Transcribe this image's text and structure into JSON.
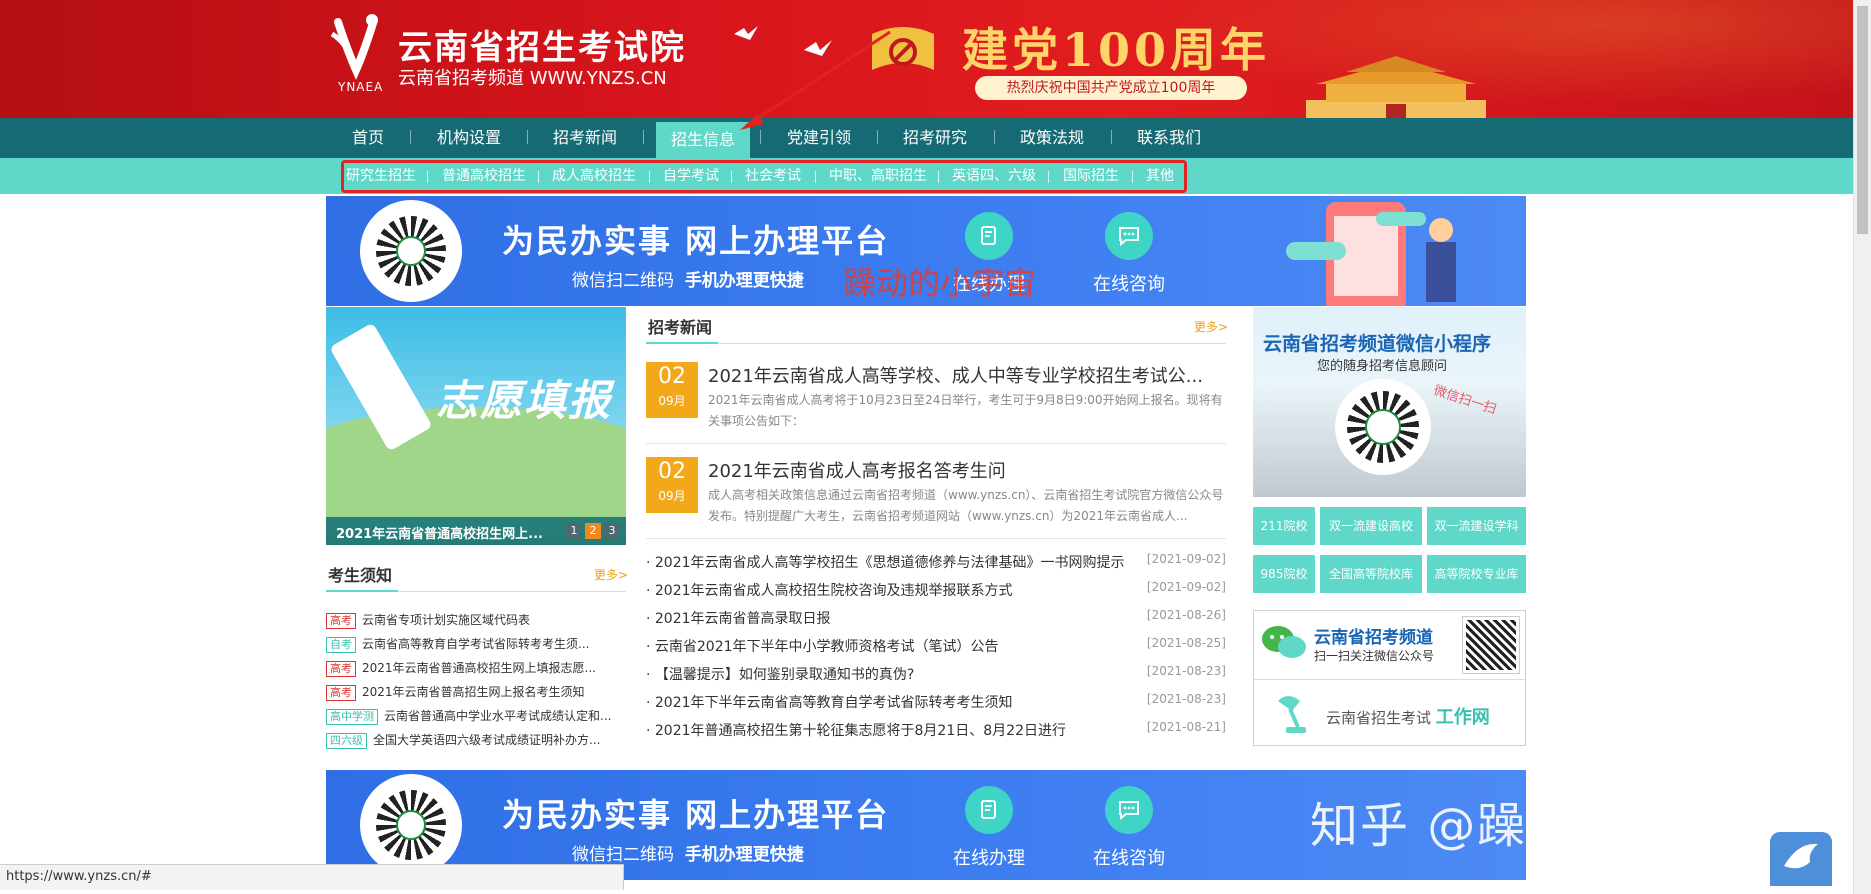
{
  "header": {
    "logo_abbr": "YNAEA",
    "site_title": "云南省招生考试院",
    "site_subtitle": "云南省招考频道 WWW.YNZS.CN",
    "party_title": "建党100周年",
    "party_subtitle": "热烈庆祝中国共产党成立100周年"
  },
  "nav": {
    "items": [
      "首页",
      "机构设置",
      "招考新闻",
      "招生信息",
      "党建引领",
      "招考研究",
      "政策法规",
      "联系我们"
    ],
    "active_index": 3
  },
  "subnav": {
    "items": [
      "研究生招生",
      "普通高校招生",
      "成人高校招生",
      "自学考试",
      "社会考试",
      "中职、高职招生",
      "英语四、六级",
      "国际招生",
      "其他"
    ]
  },
  "ad_banner": {
    "title": "为民办实事  网上办理平台",
    "sub_plain": "微信扫二维码",
    "sub_bold": "手机办理更快捷",
    "btn_online_handle": "在线办理",
    "btn_online_consult": "在线咨询"
  },
  "overlay_text": {
    "red_watermark": "躁动的小宇宙",
    "zhihu_watermark": "知乎 @躁动的小宇宙"
  },
  "slider": {
    "headline": "志愿填报",
    "caption": "2021年云南省普通高校招生网上...",
    "dots": [
      "1",
      "2",
      "3"
    ],
    "active_dot": 1
  },
  "notice": {
    "title": "考生须知",
    "more": "更多>",
    "items": [
      {
        "tag": "高考",
        "tag_color": "red",
        "text": "云南省专项计划实施区域代码表"
      },
      {
        "tag": "自考",
        "tag_color": "teal",
        "text": "云南省高等教育自学考试省际转考考生须..."
      },
      {
        "tag": "高考",
        "tag_color": "red",
        "text": "2021年云南省普通高校招生网上填报志愿..."
      },
      {
        "tag": "高考",
        "tag_color": "red",
        "text": "2021年云南省普高招生网上报名考生须知"
      },
      {
        "tag": "高中学测",
        "tag_color": "teal",
        "text": "云南省普通高中学业水平考试成绩认定和..."
      },
      {
        "tag": "四六级",
        "tag_color": "teal",
        "text": "全国大学英语四六级考试成绩证明补办方..."
      }
    ]
  },
  "news": {
    "title": "招考新闻",
    "more": "更多>",
    "highlights": [
      {
        "day": "02",
        "month": "09月",
        "title": "2021年云南省成人高等学校、成人中等专业学校招生考试公...",
        "desc": "2021年云南省成人高考将于10月23日至24日举行，考生可于9月8日9:00开始网上报名。现将有关事项公告如下："
      },
      {
        "day": "02",
        "month": "09月",
        "title": "2021年云南省成人高考报名答考生问",
        "desc": "成人高考相关政策信息通过云南省招考频道（www.ynzs.cn）、云南省招生考试院官方微信公众号发布。特别提醒广大考生，云南省招考频道网站（www.ynzs.cn）为2021年云南省成人..."
      }
    ],
    "list": [
      {
        "text": "· 2021年云南省成人高等学校招生《思想道德修养与法律基础》一书网购提示",
        "date": "[2021-09-02]"
      },
      {
        "text": "· 2021年云南省成人高校招生院校咨询及违规举报联系方式",
        "date": "[2021-09-02]"
      },
      {
        "text": "· 2021年云南省普高录取日报",
        "date": "[2021-08-26]"
      },
      {
        "text": "· 云南省2021年下半年中小学教师资格考试（笔试）公告",
        "date": "[2021-08-25]"
      },
      {
        "text": "· 【温馨提示】如何鉴别录取通知书的真伪?",
        "date": "[2021-08-23]"
      },
      {
        "text": "· 2021年下半年云南省高等教育自学考试省际转考考生须知",
        "date": "[2021-08-23]"
      },
      {
        "text": "· 2021年普通高校招生第十轮征集志愿将于8月21日、8月22日进行",
        "date": "[2021-08-21]"
      }
    ]
  },
  "mini_program": {
    "title": "云南省招考频道微信小程序",
    "subtitle": "您的随身招考信息顾问",
    "scan_hint": "微信扫一扫"
  },
  "categories": [
    "211院校",
    "双一流建设高校",
    "双一流建设学科",
    "985院校",
    "全国高等院校库",
    "高等院校专业库"
  ],
  "wechat_card": {
    "title": "云南省招考频道",
    "subtitle": "扫一扫关注微信公众号",
    "work_prefix": "云南省招生考试",
    "work_suffix": "工作网"
  },
  "statusbar": {
    "url": "https://www.ynzs.cn/#"
  },
  "colors": {
    "header_red": "#d6141b",
    "nav_teal": "#156a73",
    "subnav_teal": "#5fd8c9",
    "date_orange": "#f3a81a",
    "ad_blue": "#3b7cf0"
  }
}
